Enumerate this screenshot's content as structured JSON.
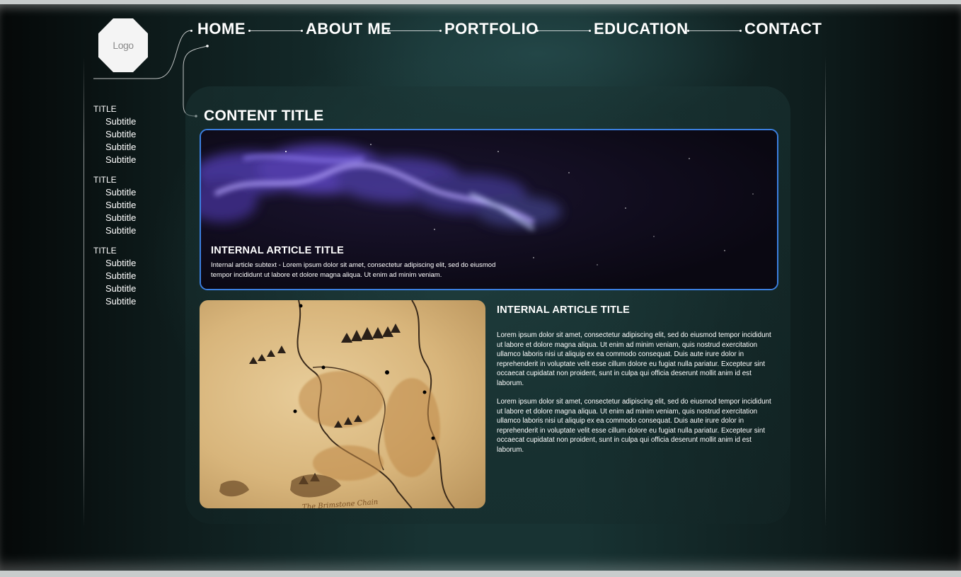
{
  "logo": {
    "label": "Logo"
  },
  "nav": {
    "items": [
      {
        "label": "HOME"
      },
      {
        "label": "ABOUT ME"
      },
      {
        "label": "PORTFOLIO"
      },
      {
        "label": "EDUCATION"
      },
      {
        "label": "CONTACT"
      }
    ]
  },
  "sidebar": {
    "groups": [
      {
        "title": "TITLE",
        "subtitles": [
          "Subtitle",
          "Subtitle",
          "Subtitle",
          "Subtitle"
        ]
      },
      {
        "title": "TITLE",
        "subtitles": [
          "Subtitle",
          "Subtitle",
          "Subtitle",
          "Subtitle"
        ]
      },
      {
        "title": "TITLE",
        "subtitles": [
          "Subtitle",
          "Subtitle",
          "Subtitle",
          "Subtitle"
        ]
      }
    ]
  },
  "main": {
    "content_title": "CONTENT TITLE",
    "featured": {
      "title": "INTERNAL ARTICLE TITLE",
      "subtext": "Internal article subtext - Lorem ipsum dolor sit amet, consectetur adipiscing elit, sed do eiusmod tempor incididunt ut labore et dolore magna aliqua. Ut enim ad minim veniam."
    },
    "article": {
      "title": "INTERNAL ARTICLE TITLE",
      "paragraphs": [
        "Lorem ipsum dolor sit amet, consectetur adipiscing elit, sed do eiusmod tempor incididunt ut labore et dolore magna aliqua. Ut enim ad minim veniam, quis nostrud exercitation ullamco laboris nisi ut aliquip ex ea commodo consequat. Duis aute irure dolor in reprehenderit in voluptate velit esse cillum dolore eu fugiat nulla pariatur. Excepteur sint occaecat cupidatat non proident, sunt in culpa qui officia deserunt mollit anim id est laborum.",
        "Lorem ipsum dolor sit amet, consectetur adipiscing elit, sed do eiusmod tempor incididunt ut labore et dolore magna aliqua. Ut enim ad minim veniam, quis nostrud exercitation ullamco laboris nisi ut aliquip ex ea commodo consequat. Duis aute irure dolor in reprehenderit in voluptate velit esse cillum dolore eu fugiat nulla pariatur. Excepteur sint occaecat cupidatat non proident, sunt in culpa qui officia deserunt mollit anim id est laborum."
      ]
    },
    "map_labels": [
      "The Brimstone Chain"
    ]
  },
  "colors": {
    "featured_border": "#3b7fe0",
    "text": "#ffffff",
    "background_teal": "#183333"
  }
}
